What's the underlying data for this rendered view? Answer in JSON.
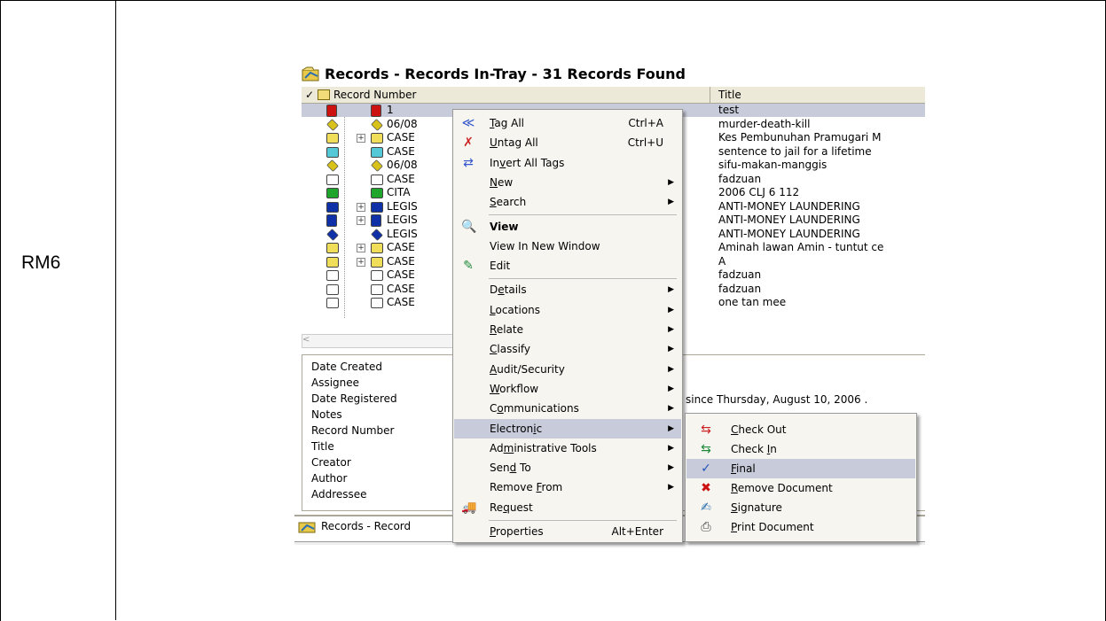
{
  "row_label": "RM6",
  "window": {
    "title": "Records - Records In-Tray - 31 Records Found",
    "columns": [
      "Record Number",
      "Title"
    ]
  },
  "records": [
    {
      "number": "1",
      "title": "test",
      "color": "#cc1111",
      "shape": "doc",
      "selected": true
    },
    {
      "number": "06/08",
      "title": "murder-death-kill",
      "color": "#d8c21a",
      "shape": "diamond"
    },
    {
      "number": "CASE",
      "title": "Kes Pembunuhan Pramugari M",
      "color": "#f0dd5a",
      "shape": "folder",
      "expand": true
    },
    {
      "number": "CASE",
      "title": "sentence to jail for a lifetime",
      "color": "#55c8d8",
      "shape": "folder"
    },
    {
      "number": "06/08",
      "title": "sifu-makan-manggis",
      "color": "#d8c21a",
      "shape": "diamond"
    },
    {
      "number": "CASE",
      "title": "fadzuan",
      "color": "#ffffff",
      "shape": "folder"
    },
    {
      "number": "CITA",
      "title": "2006 CLJ 6 112",
      "color": "#1fa52b",
      "shape": "folder"
    },
    {
      "number": "LEGIS",
      "title": "ANTI-MONEY LAUNDERING",
      "color": "#1030a8",
      "shape": "folder",
      "expand": true
    },
    {
      "number": "LEGIS",
      "title": "ANTI-MONEY LAUNDERING",
      "color": "#1030a8",
      "shape": "doc",
      "expand": true
    },
    {
      "number": "LEGIS",
      "title": "ANTI-MONEY LAUNDERING",
      "color": "#1030a8",
      "shape": "diamond"
    },
    {
      "number": "CASE",
      "title": "Aminah lawan Amin - tuntut ce",
      "color": "#f0dd5a",
      "shape": "folder",
      "expand": true
    },
    {
      "number": "CASE",
      "title": "A",
      "color": "#f0dd5a",
      "shape": "folder",
      "expand": true
    },
    {
      "number": "CASE",
      "title": "fadzuan",
      "color": "#ffffff",
      "shape": "folder"
    },
    {
      "number": "CASE",
      "title": "fadzuan",
      "color": "#ffffff",
      "shape": "folder"
    },
    {
      "number": "CASE",
      "title": "one tan mee",
      "color": "#ffffff",
      "shape": "folder"
    }
  ],
  "properties": {
    "labels": [
      "Date Created",
      "Assignee",
      "Date Registered",
      "Notes",
      "Record Number",
      "Title",
      "Creator",
      "Author",
      "Addressee"
    ],
    "assignee_value": "since Thursday, August 10, 2006 ."
  },
  "taskbar_label": "Records - Record",
  "menu": [
    {
      "label": "Tag All",
      "u": "T",
      "accel": "Ctrl+A",
      "icon": "tag-all-icon",
      "glyph": "≪",
      "gcolor": "#3355cc"
    },
    {
      "label": "Untag All",
      "u": "U",
      "accel": "Ctrl+U",
      "icon": "untag-all-icon",
      "glyph": "✗",
      "gcolor": "#cc2222"
    },
    {
      "label": "Invert All Tags",
      "u": "v",
      "icon": "invert-tags-icon",
      "glyph": "⇄",
      "gcolor": "#3355cc"
    },
    {
      "label": "New",
      "u": "N",
      "submenu": true
    },
    {
      "label": "Search",
      "u": "S",
      "submenu": true,
      "sep_after": true
    },
    {
      "label": "View",
      "bold": true,
      "icon": "view-icon",
      "glyph": "🔍",
      "gcolor": "#2a6fb0"
    },
    {
      "label": "View In New Window"
    },
    {
      "label": "Edit",
      "icon": "edit-icon",
      "glyph": "✎",
      "gcolor": "#1f8a3a",
      "sep_after": true
    },
    {
      "label": "Details",
      "u": "e",
      "submenu": true
    },
    {
      "label": "Locations",
      "u": "L",
      "submenu": true
    },
    {
      "label": "Relate",
      "u": "R",
      "submenu": true
    },
    {
      "label": "Classify",
      "u": "C",
      "submenu": true
    },
    {
      "label": "Audit/Security",
      "u": "A",
      "submenu": true
    },
    {
      "label": "Workflow",
      "u": "W",
      "submenu": true
    },
    {
      "label": "Communications",
      "u": "o",
      "submenu": true
    },
    {
      "label": "Electronic",
      "u": "i",
      "submenu": true,
      "highlight": true
    },
    {
      "label": "Administrative Tools",
      "u": "m",
      "submenu": true
    },
    {
      "label": "Send To",
      "u": "d",
      "submenu": true
    },
    {
      "label": "Remove From",
      "u": "F",
      "submenu": true
    },
    {
      "label": "Request",
      "u": "q",
      "icon": "request-icon",
      "glyph": "🚚",
      "gcolor": "#cc2222",
      "sep_after": true
    },
    {
      "label": "Properties",
      "u": "P",
      "accel": "Alt+Enter"
    }
  ],
  "submenu": [
    {
      "label": "Check Out",
      "u": "C",
      "icon": "check-out-icon",
      "glyph": "⇆",
      "gcolor": "#cc2222"
    },
    {
      "label": "Check In",
      "u": "I",
      "icon": "check-in-icon",
      "glyph": "⇆",
      "gcolor": "#1f8a3a"
    },
    {
      "label": "Final",
      "u": "F",
      "icon": "final-icon",
      "glyph": "✓",
      "gcolor": "#2255bb",
      "highlight": true
    },
    {
      "label": "Remove Document",
      "u": "R",
      "icon": "remove-document-icon",
      "glyph": "✖",
      "gcolor": "#cc1111"
    },
    {
      "label": "Signature",
      "u": "S",
      "icon": "signature-icon",
      "glyph": "✍",
      "gcolor": "#2a6fb0"
    },
    {
      "label": "Print Document",
      "u": "P",
      "icon": "print-document-icon",
      "glyph": "⎙",
      "gcolor": "#444444"
    }
  ]
}
